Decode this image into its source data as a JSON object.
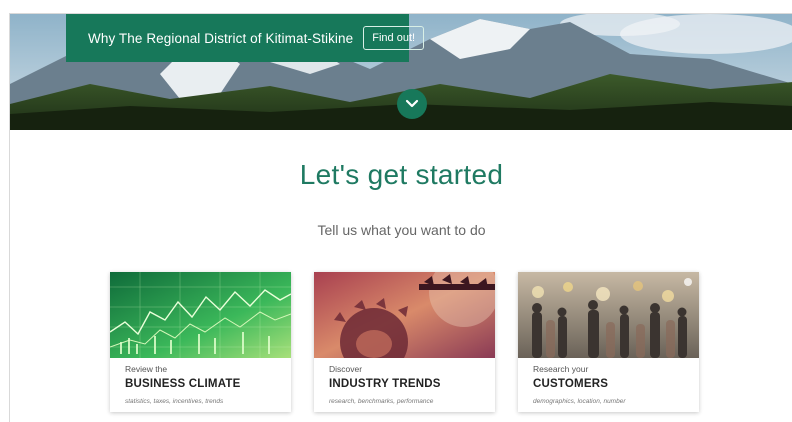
{
  "hero": {
    "promo_text": "Why The Regional District of Kitimat-Stikine",
    "promo_button": "Find out!",
    "scroll_icon": "chevron-down-icon"
  },
  "main": {
    "headline": "Let's get started",
    "subheadline": "Tell us what you want to do"
  },
  "cards": [
    {
      "pre": "Review the",
      "title": "BUSINESS CLIMATE",
      "tags": "statistics, taxes, incentives, trends",
      "image": "green-stock-chart-image"
    },
    {
      "pre": "Discover",
      "title": "INDUSTRY TRENDS",
      "tags": "research, benchmarks, performance",
      "image": "industrial-gears-image"
    },
    {
      "pre": "Research your",
      "title": "CUSTOMERS",
      "tags": "demographics, location, number",
      "image": "street-market-crowd-image"
    }
  ],
  "colors": {
    "brand_green": "#17785a",
    "headline_green": "#1f7a62"
  }
}
